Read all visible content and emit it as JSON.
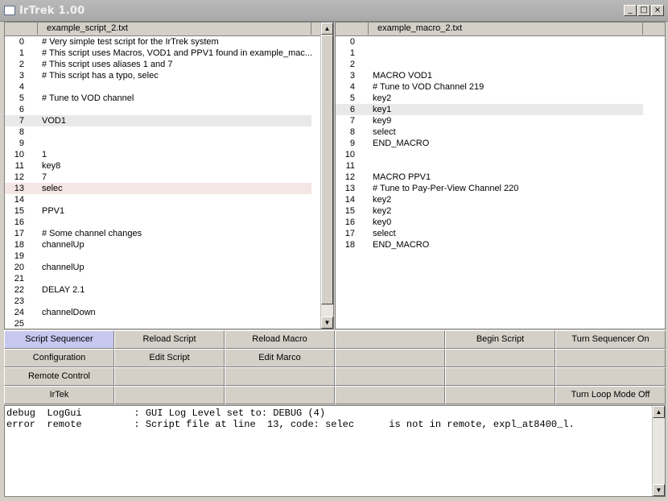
{
  "window": {
    "title": "IrTrek 1.00",
    "minimize": "_",
    "maximize": "□",
    "close": "×"
  },
  "script_pane": {
    "filename": "example_script_2.txt",
    "rows": [
      {
        "n": "0",
        "t": "# Very simple test script for the IrTrek system",
        "hl": ""
      },
      {
        "n": "1",
        "t": "# This script uses Macros, VOD1 and PPV1 found in example_mac...",
        "hl": ""
      },
      {
        "n": "2",
        "t": "# This script uses aliases 1 and 7",
        "hl": ""
      },
      {
        "n": "3",
        "t": "# This script has a typo, selec",
        "hl": ""
      },
      {
        "n": "4",
        "t": "",
        "hl": ""
      },
      {
        "n": "5",
        "t": "# Tune to VOD channel",
        "hl": ""
      },
      {
        "n": "6",
        "t": "",
        "hl": ""
      },
      {
        "n": "7",
        "t": "VOD1",
        "hl": "gray"
      },
      {
        "n": "8",
        "t": "",
        "hl": ""
      },
      {
        "n": "9",
        "t": "",
        "hl": ""
      },
      {
        "n": "10",
        "t": "1",
        "hl": ""
      },
      {
        "n": "11",
        "t": "key8",
        "hl": ""
      },
      {
        "n": "12",
        "t": "7",
        "hl": ""
      },
      {
        "n": "13",
        "t": "selec",
        "hl": "pink"
      },
      {
        "n": "14",
        "t": "",
        "hl": ""
      },
      {
        "n": "15",
        "t": "PPV1",
        "hl": ""
      },
      {
        "n": "16",
        "t": "",
        "hl": ""
      },
      {
        "n": "17",
        "t": "# Some channel changes",
        "hl": ""
      },
      {
        "n": "18",
        "t": "channelUp",
        "hl": ""
      },
      {
        "n": "19",
        "t": "",
        "hl": ""
      },
      {
        "n": "20",
        "t": "channelUp",
        "hl": ""
      },
      {
        "n": "21",
        "t": "",
        "hl": ""
      },
      {
        "n": "22",
        "t": "DELAY 2.1",
        "hl": ""
      },
      {
        "n": "23",
        "t": "",
        "hl": ""
      },
      {
        "n": "24",
        "t": "channelDown",
        "hl": ""
      },
      {
        "n": "25",
        "t": "",
        "hl": ""
      }
    ]
  },
  "macro_pane": {
    "filename": "example_macro_2.txt",
    "rows": [
      {
        "n": "0",
        "t": "",
        "hl": ""
      },
      {
        "n": "1",
        "t": "",
        "hl": ""
      },
      {
        "n": "2",
        "t": "",
        "hl": ""
      },
      {
        "n": "3",
        "t": "MACRO VOD1",
        "hl": ""
      },
      {
        "n": "4",
        "t": "# Tune to VOD Channel 219",
        "hl": ""
      },
      {
        "n": "5",
        "t": "key2",
        "hl": ""
      },
      {
        "n": "6",
        "t": "key1",
        "hl": "gray"
      },
      {
        "n": "7",
        "t": "key9",
        "hl": ""
      },
      {
        "n": "8",
        "t": "select",
        "hl": ""
      },
      {
        "n": "9",
        "t": "END_MACRO",
        "hl": ""
      },
      {
        "n": "10",
        "t": "",
        "hl": ""
      },
      {
        "n": "11",
        "t": "",
        "hl": ""
      },
      {
        "n": "12",
        "t": "MACRO PPV1",
        "hl": ""
      },
      {
        "n": "13",
        "t": "# Tune to Pay-Per-View Channel 220",
        "hl": ""
      },
      {
        "n": "14",
        "t": "key2",
        "hl": ""
      },
      {
        "n": "15",
        "t": "key2",
        "hl": ""
      },
      {
        "n": "16",
        "t": "key0",
        "hl": ""
      },
      {
        "n": "17",
        "t": "select",
        "hl": ""
      },
      {
        "n": "18",
        "t": "END_MACRO",
        "hl": ""
      }
    ]
  },
  "buttons": [
    [
      "Script Sequencer",
      "Reload Script",
      "Reload Macro",
      "",
      "Begin Script",
      "Turn Sequencer On"
    ],
    [
      "Configuration",
      "Edit Script",
      "Edit Marco",
      "",
      "",
      ""
    ],
    [
      "Remote Control",
      "",
      "",
      "",
      "",
      ""
    ],
    [
      "IrTek",
      "",
      "",
      "",
      "",
      "Turn Loop Mode Off"
    ]
  ],
  "active_button": "Script Sequencer",
  "log": [
    "debug  LogGui         : GUI Log Level set to: DEBUG (4)",
    "error  remote         : Script file at line  13, code: selec      is not in remote, expl_at8400_l."
  ],
  "colors": {
    "selection": "#e9e9ea",
    "error_row": "#f3e6e3",
    "active_button": "#c6c8f0"
  }
}
